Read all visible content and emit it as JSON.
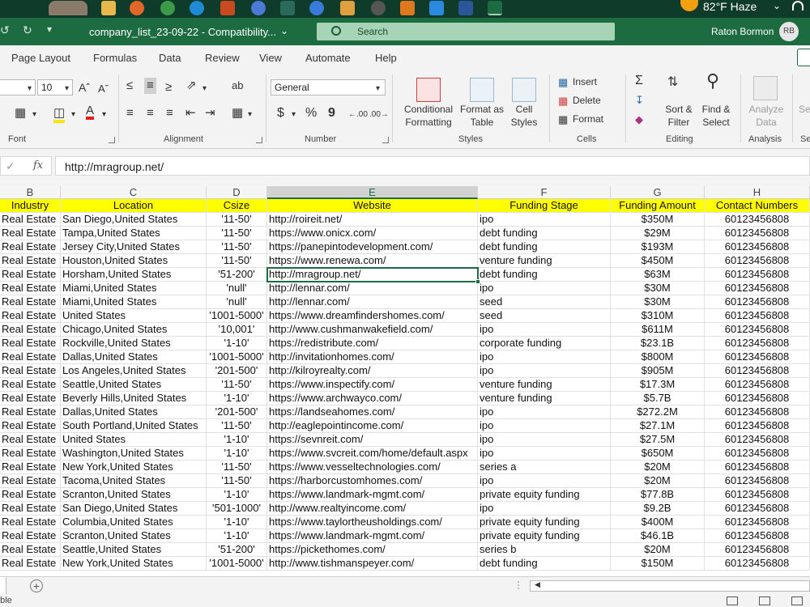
{
  "window": {
    "doc_title": "company_list_23-09-22  -  Compatibility...",
    "search_placeholder": "Search",
    "user_name": "Raton Bormon",
    "user_initials": "RB",
    "weather": "82°F  Haze"
  },
  "menu": [
    "Page Layout",
    "Formulas",
    "Data",
    "Review",
    "View",
    "Automate",
    "Help"
  ],
  "ribbon": {
    "font_size": "10",
    "number_format": "General",
    "groups": [
      "Font",
      "Alignment",
      "Number",
      "Styles",
      "Cells",
      "Editing",
      "Analysis",
      "Se"
    ],
    "styles": {
      "conditional": [
        "Conditional",
        "Formatting"
      ],
      "format_table": [
        "Format as",
        "Table"
      ],
      "cell_styles": [
        "Cell",
        "Styles"
      ]
    },
    "cells": {
      "insert": "Insert",
      "delete": "Delete",
      "format": "Format"
    },
    "editing": {
      "sort": [
        "Sort &",
        "Filter"
      ],
      "find": [
        "Find &",
        "Select"
      ]
    },
    "analysis": [
      "Analyze",
      "Data"
    ],
    "percent": "%",
    "comma": "9",
    "currency": "$",
    "se_label": "Se"
  },
  "formula": {
    "value": "http://mragroup.net/",
    "fx": "fx",
    "cancel": "✓"
  },
  "columns": [
    "B",
    "C",
    "D",
    "E",
    "F",
    "G",
    "H"
  ],
  "selected_column": "E",
  "header_row": [
    "Industry",
    "Location",
    "Csize",
    "Website",
    "Funding Stage",
    "Funding Amount",
    "Contact Numbers"
  ],
  "rows": [
    [
      "Real Estate",
      "San Diego,United States",
      "'11-50'",
      "http://roireit.net/",
      "ipo",
      "$350M",
      "60123456808"
    ],
    [
      "Real Estate",
      "Tampa,United States",
      "'11-50'",
      "https://www.onicx.com/",
      "debt funding",
      "$29M",
      "60123456808"
    ],
    [
      "Real Estate",
      "Jersey City,United States",
      "'11-50'",
      "https://panepintodevelopment.com/",
      "debt funding",
      "$193M",
      "60123456808"
    ],
    [
      "Real Estate",
      "Houston,United States",
      "'11-50'",
      "https://www.renewa.com/",
      "venture funding",
      "$450M",
      "60123456808"
    ],
    [
      "Real Estate",
      "Horsham,United States",
      "'51-200'",
      "http://mragroup.net/",
      "debt funding",
      "$63M",
      "60123456808"
    ],
    [
      "Real Estate",
      "Miami,United States",
      "'null'",
      "http://lennar.com/",
      "ipo",
      "$30M",
      "60123456808"
    ],
    [
      "Real Estate",
      "Miami,United States",
      "'null'",
      "http://lennar.com/",
      "seed",
      "$30M",
      "60123456808"
    ],
    [
      "Real Estate",
      "United States",
      "'1001-5000'",
      "https://www.dreamfindershomes.com/",
      "seed",
      "$310M",
      "60123456808"
    ],
    [
      "Real Estate",
      "Chicago,United States",
      "'10,001'",
      "http://www.cushmanwakefield.com/",
      "ipo",
      "$611M",
      "60123456808"
    ],
    [
      "Real Estate",
      "Rockville,United States",
      "'1-10'",
      "https://redistribute.com/",
      "corporate funding",
      "$23.1B",
      "60123456808"
    ],
    [
      "Real Estate",
      "Dallas,United States",
      "'1001-5000'",
      "http://invitationhomes.com/",
      "ipo",
      "$800M",
      "60123456808"
    ],
    [
      "Real Estate",
      "Los Angeles,United States",
      "'201-500'",
      "http://kilroyrealty.com/",
      "ipo",
      "$905M",
      "60123456808"
    ],
    [
      "Real Estate",
      "Seattle,United States",
      "'11-50'",
      "https://www.inspectify.com/",
      "venture funding",
      "$17.3M",
      "60123456808"
    ],
    [
      "Real Estate",
      "Beverly Hills,United States",
      "'1-10'",
      "https://www.archwayco.com/",
      "venture funding",
      "$5.7B",
      "60123456808"
    ],
    [
      "Real Estate",
      "Dallas,United States",
      "'201-500'",
      "https://landseahomes.com/",
      "ipo",
      "$272.2M",
      "60123456808"
    ],
    [
      "Real Estate",
      "South Portland,United States",
      "'11-50'",
      "http://eaglepointincome.com/",
      "ipo",
      "$27.1M",
      "60123456808"
    ],
    [
      "Real Estate",
      "United States",
      "'1-10'",
      "https://sevnreit.com/",
      "ipo",
      "$27.5M",
      "60123456808"
    ],
    [
      "Real Estate",
      "Washington,United States",
      "'1-10'",
      "https://www.svcreit.com/home/default.aspx",
      "ipo",
      "$650M",
      "60123456808"
    ],
    [
      "Real Estate",
      "New York,United States",
      "'11-50'",
      "https://www.vesseltechnologies.com/",
      "series a",
      "$20M",
      "60123456808"
    ],
    [
      "Real Estate",
      "Tacoma,United States",
      "'11-50'",
      "https://harborcustomhomes.com/",
      "ipo",
      "$20M",
      "60123456808"
    ],
    [
      "Real Estate",
      "Scranton,United States",
      "'1-10'",
      "https://www.landmark-mgmt.com/",
      "private equity funding",
      "$77.8B",
      "60123456808"
    ],
    [
      "Real Estate",
      "San Diego,United States",
      "'501-1000'",
      "http://www.realtyincome.com/",
      "ipo",
      "$9.2B",
      "60123456808"
    ],
    [
      "Real Estate",
      "Columbia,United States",
      "'1-10'",
      "https://www.taylortheusholdings.com/",
      "private equity funding",
      "$400M",
      "60123456808"
    ],
    [
      "Real Estate",
      "Scranton,United States",
      "'1-10'",
      "https://www.landmark-mgmt.com/",
      "private equity funding",
      "$46.1B",
      "60123456808"
    ],
    [
      "Real Estate",
      "Seattle,United States",
      "'51-200'",
      "https://pickethomes.com/",
      "series b",
      "$20M",
      "60123456808"
    ],
    [
      "Real Estate",
      "New York,United States",
      "'1001-5000'",
      "http://www.tishmanspeyer.com/",
      "debt funding",
      "$150M",
      "60123456808"
    ]
  ],
  "sheet": {
    "add_label": "+",
    "dots": "⋮"
  },
  "status": {
    "text": "able"
  },
  "colors": {
    "accent": "#1d6b41",
    "header_fill": "#ffff00"
  }
}
